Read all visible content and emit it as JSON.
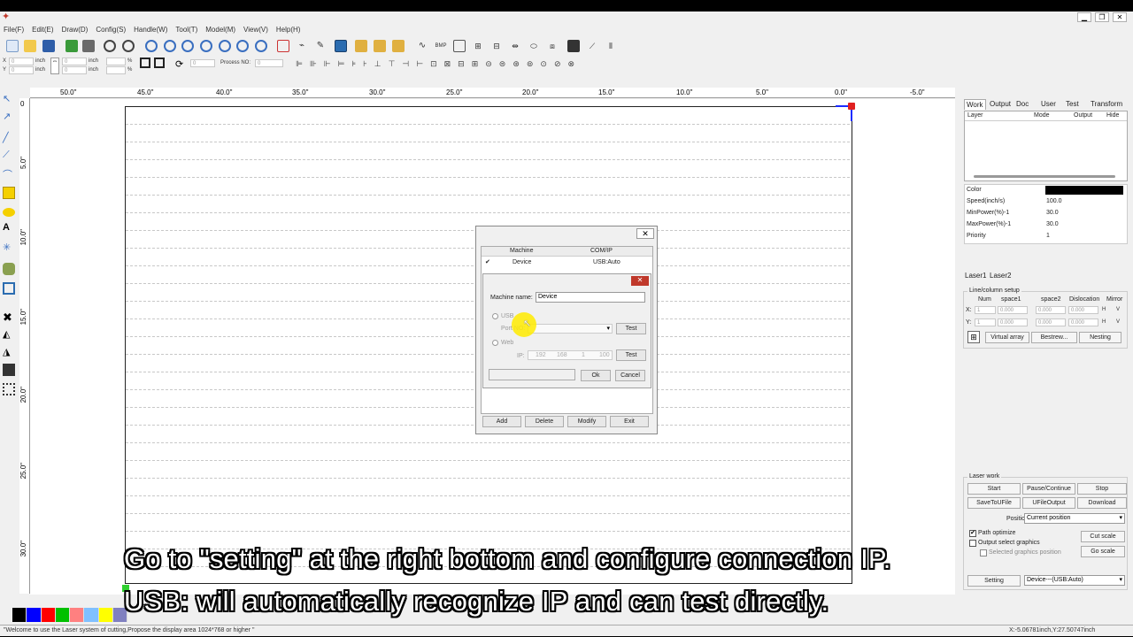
{
  "menu": [
    "File(F)",
    "Edit(E)",
    "Draw(D)",
    "Config(S)",
    "Handle(W)",
    "Tool(T)",
    "Model(M)",
    "View(V)",
    "Help(H)"
  ],
  "props": {
    "x_label": "X",
    "y_label": "Y",
    "x_value": "0",
    "y_value": "0",
    "unit1": "inch",
    "unit2": "inch",
    "w_value": "0",
    "h_value": "0",
    "unit3": "inch",
    "unit4": "inch",
    "pct1": "%",
    "pct2": "%",
    "rot_value": "0",
    "process_label": "Process NO:",
    "process_value": "0"
  },
  "ruler": {
    "h_labels": [
      "50.0\"",
      "45.0\"",
      "40.0\"",
      "35.0\"",
      "30.0\"",
      "25.0\"",
      "20.0\"",
      "15.0\"",
      "10.0\"",
      "5.0\"",
      "0.0\"",
      "-5.0\""
    ],
    "v_labels": [
      "0",
      "5.0\"",
      "10.0\"",
      "15.0\"",
      "20.0\"",
      "25.0\"",
      "30.0\""
    ]
  },
  "right_panel": {
    "tabs": [
      "Work",
      "Output",
      "Doc",
      "User",
      "Test",
      "Transform"
    ],
    "layer_cols": [
      "Layer",
      "Mode",
      "Output",
      "Hide"
    ],
    "props": [
      {
        "label": "Color",
        "value": ""
      },
      {
        "label": "Speed(inch/s)",
        "value": "100.0"
      },
      {
        "label": "MinPower(%)-1",
        "value": "30.0"
      },
      {
        "label": "MaxPower(%)-1",
        "value": "30.0"
      },
      {
        "label": "Priority",
        "value": "1"
      }
    ],
    "color_value": "#000000",
    "laser_tabs": [
      "Laser1",
      "Laser2"
    ],
    "array_title": "Line/column setup",
    "array_cols": [
      "Num",
      "space1",
      "space2",
      "Dislocation",
      "Mirror"
    ],
    "row_x": "X:",
    "row_y": "Y:",
    "x_num": "1",
    "y_num": "1",
    "x_s1": "0.000",
    "x_s2": "0.000",
    "x_dis": "0.000",
    "y_s1": "0.000",
    "y_s2": "0.000",
    "y_dis": "0.000",
    "mirror_h": "H",
    "mirror_v": "V",
    "virtual_array": "Virtual array",
    "bestrew": "Bestrew...",
    "nesting": "Nesting",
    "laser_work": "Laser work",
    "start": "Start",
    "pause": "Pause/Continue",
    "stop": "Stop",
    "save_u": "SaveToUFile",
    "u_output": "UFileOutput",
    "download": "Download",
    "position_label": "Position:",
    "position_value": "Current position",
    "path_optimize": "Path optimize",
    "output_select": "Output select graphics",
    "selected_pos": "Selected graphics position",
    "cut_scale": "Cut scale",
    "go_scale": "Go scale",
    "setting": "Setting",
    "device_value": "Device---(USB:Auto)"
  },
  "dialog": {
    "col_machine": "Machine",
    "col_comip": "COM/IP",
    "row_check": "✔",
    "row_machine": "Device",
    "row_comip": "USB:Auto",
    "machine_name_label": "Machine name:",
    "machine_name_value": "Device",
    "usb_label": "USB",
    "port_label": "Port NO:",
    "test1": "Test",
    "web_label": "Web",
    "ip_label": "IP:",
    "ip1": "192",
    "ip2": "168",
    "ip3": "1",
    "ip4": "100",
    "test2": "Test",
    "ok": "Ok",
    "cancel": "Cancel",
    "add": "Add",
    "delete": "Delete",
    "modify": "Modify",
    "exit": "Exit"
  },
  "palette": [
    "#000000",
    "#0000ff",
    "#ff0000",
    "#00c000",
    "#ff8080",
    "#80c0ff",
    "#ffff00",
    "#8080c0"
  ],
  "status": {
    "message": "\"Welcome to use the Laser system of cutting,Propose the display area 1024*768 or higher \"",
    "coords": "X:-5.06781inch,Y:27.50747inch"
  },
  "subtitles": {
    "line1": "Go to \"setting\" at the right bottom and configure connection IP.",
    "line2": "USB: will automatically recognize IP and can test directly."
  }
}
